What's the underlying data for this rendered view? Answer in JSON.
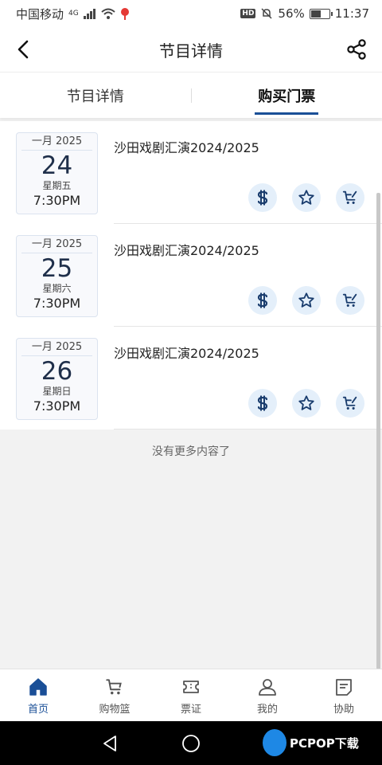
{
  "status_bar": {
    "carrier": "中国移动",
    "network": "4G",
    "hd": "HD",
    "battery": "56%",
    "battery_level": 0.56,
    "time": "11:37"
  },
  "header": {
    "title": "节目详情",
    "back_icon": "chevron-left-icon",
    "share_icon": "share-icon"
  },
  "tabs": [
    {
      "label": "节目详情",
      "active": false
    },
    {
      "label": "购买门票",
      "active": true
    }
  ],
  "events": [
    {
      "month": "一月 2025",
      "day": "24",
      "weekday": "星期五",
      "time": "7:30PM",
      "title": "沙田戏剧汇演2024/2025"
    },
    {
      "month": "一月 2025",
      "day": "25",
      "weekday": "星期六",
      "time": "7:30PM",
      "title": "沙田戏剧汇演2024/2025"
    },
    {
      "month": "一月 2025",
      "day": "26",
      "weekday": "星期日",
      "time": "7:30PM",
      "title": "沙田戏剧汇演2024/2025"
    }
  ],
  "event_actions": [
    "price-icon",
    "star-icon",
    "cart-icon"
  ],
  "no_more_text": "没有更多内容了",
  "bottom_nav": [
    {
      "label": "首页",
      "icon": "home-icon",
      "active": true
    },
    {
      "label": "购物篮",
      "icon": "basket-icon",
      "active": false
    },
    {
      "label": "票证",
      "icon": "ticket-icon",
      "active": false
    },
    {
      "label": "我的",
      "icon": "user-icon",
      "active": false
    },
    {
      "label": "协助",
      "icon": "help-icon",
      "active": false
    }
  ],
  "watermark": "PCPOP下载",
  "colors": {
    "accent": "#1a4f97",
    "icon_bg": "#e4effa"
  }
}
